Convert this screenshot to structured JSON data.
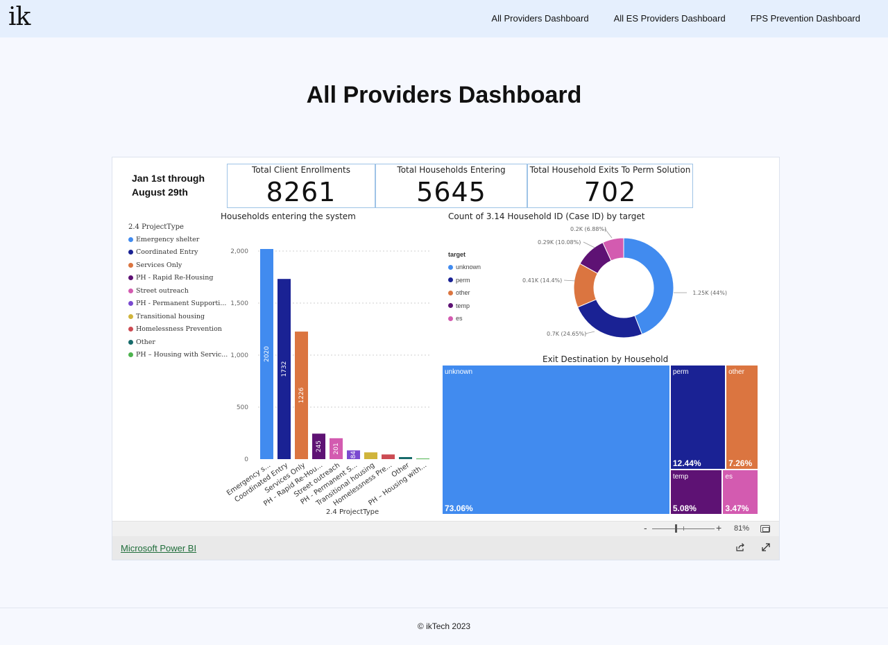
{
  "nav": {
    "logo": "ik",
    "links": [
      "All Providers Dashboard",
      "All ES Providers Dashboard",
      "FPS Prevention Dashboard"
    ]
  },
  "page": {
    "title": "All Providers Dashboard"
  },
  "report": {
    "date_range": "Jan 1st through August 29th",
    "kpis": [
      {
        "title": "Total Client Enrollments",
        "value": "8261"
      },
      {
        "title": "Total Households Entering",
        "value": "5645"
      },
      {
        "title": "Total Household Exits To Perm Solution",
        "value": "702"
      }
    ],
    "project_legend": {
      "title": "2.4 ProjectType",
      "items": [
        {
          "label": "Emergency shelter",
          "color": "#418bef"
        },
        {
          "label": "Coordinated Entry",
          "color": "#1a2294"
        },
        {
          "label": "Services Only",
          "color": "#db7540"
        },
        {
          "label": "PH - Rapid Re-Housing",
          "color": "#5e1274"
        },
        {
          "label": "Street outreach",
          "color": "#d35bb0"
        },
        {
          "label": "PH - Permanent Supporti...",
          "color": "#7a4ad0"
        },
        {
          "label": "Transitional housing",
          "color": "#d0b43b"
        },
        {
          "label": "Homelessness Prevention",
          "color": "#cc4b53"
        },
        {
          "label": "Other",
          "color": "#176b6b"
        },
        {
          "label": "PH – Housing with Servic...",
          "color": "#4db34e"
        }
      ]
    },
    "target_legend": {
      "title": "target",
      "items": [
        {
          "label": "unknown",
          "color": "#418bef"
        },
        {
          "label": "perm",
          "color": "#1a2294"
        },
        {
          "label": "other",
          "color": "#db7540"
        },
        {
          "label": "temp",
          "color": "#5e1274"
        },
        {
          "label": "es",
          "color": "#d35bb0"
        }
      ]
    },
    "zoom": {
      "minus": "-",
      "plus": "+",
      "level": "81%"
    },
    "powerbi_link": "Microsoft Power BI"
  },
  "chart_data": [
    {
      "type": "bar",
      "title": "Households entering the system",
      "xlabel": "2.4 ProjectType",
      "ylabel": "",
      "ylim": [
        0,
        2100
      ],
      "yticks": [
        0,
        500,
        1000,
        1500,
        2000
      ],
      "ytick_labels": [
        "0",
        "500",
        "1,000",
        "1,500",
        "2,000"
      ],
      "grid": true,
      "categories": [
        "Emergency s...",
        "Coordinated Entry",
        "Services Only",
        "PH - Rapid Re-Hou...",
        "Street outreach",
        "PH - Permanent S...",
        "Transitional housing",
        "Homelessness Pre...",
        "Other",
        "PH – Housing with..."
      ],
      "values": [
        2020,
        1732,
        1226,
        245,
        201,
        84,
        65,
        45,
        20,
        6
      ],
      "data_labels": [
        "2020",
        "1732",
        "1226",
        "245",
        "201",
        "84",
        "",
        "",
        "",
        ""
      ],
      "colors": [
        "#418bef",
        "#1a2294",
        "#db7540",
        "#5e1274",
        "#d35bb0",
        "#7a4ad0",
        "#d0b43b",
        "#cc4b53",
        "#176b6b",
        "#4db34e"
      ]
    },
    {
      "type": "pie",
      "title": "Count of 3.14 Household ID (Case ID) by target",
      "categories": [
        "unknown",
        "perm",
        "other",
        "temp",
        "es"
      ],
      "values": [
        44,
        24.65,
        14.4,
        10.08,
        6.88
      ],
      "data_labels": [
        "1.25K (44%)",
        "0.7K (24.65%)",
        "0.41K (14.4%)",
        "0.29K (10.08%)",
        "0.2K (6.88%)"
      ],
      "colors": [
        "#418bef",
        "#1a2294",
        "#db7540",
        "#5e1274",
        "#d35bb0"
      ],
      "legend": "left"
    },
    {
      "type": "treemap",
      "title": "Exit Destination by Household",
      "categories": [
        "unknown",
        "perm",
        "other",
        "temp",
        "es"
      ],
      "values": [
        73.06,
        12.44,
        7.26,
        5.08,
        3.47
      ],
      "data_labels": [
        "73.06%",
        "12.44%",
        "7.26%",
        "5.08%",
        "3.47%"
      ],
      "colors": [
        "#418bef",
        "#1a2294",
        "#db7540",
        "#5e1274",
        "#d35bb0"
      ]
    }
  ],
  "footer": {
    "copyright": "© ikTech 2023"
  }
}
